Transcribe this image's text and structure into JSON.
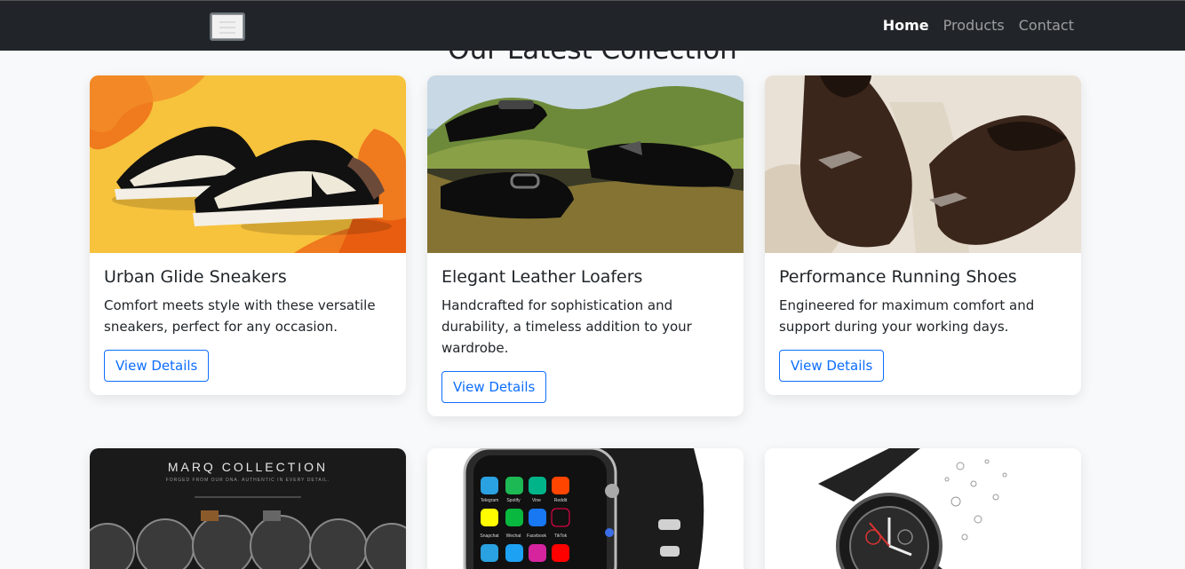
{
  "nav": {
    "links": [
      "Home",
      "Products",
      "Contact"
    ]
  },
  "page": {
    "heading": "Our Latest Collection"
  },
  "products": [
    {
      "title": "Urban Glide Sneakers",
      "description": "Comfort meets style with these versatile sneakers, perfect for any occasion.",
      "button": "View Details"
    },
    {
      "title": "Elegant Leather Loafers",
      "description": "Handcrafted for sophistication and durability, a timeless addition to your wardrobe.",
      "button": "View Details"
    },
    {
      "title": "Performance Running Shoes",
      "description": "Engineered for maximum comfort and support during your working days.",
      "button": "View Details"
    }
  ],
  "lower_cards": {
    "marq_title": "MARQ COLLECTION",
    "marq_subtitle": "FORGED FROM OUR DNA. AUTHENTIC IN EVERY DETAIL.",
    "app_labels": [
      "Telegram",
      "Spotify",
      "Vine",
      "Reddit",
      "Snapchat",
      "Wechat",
      "Facebook",
      "TikTok"
    ]
  },
  "colors": {
    "navbar": "#212529",
    "accent": "#0d6efd",
    "background": "#f8f9fa"
  }
}
